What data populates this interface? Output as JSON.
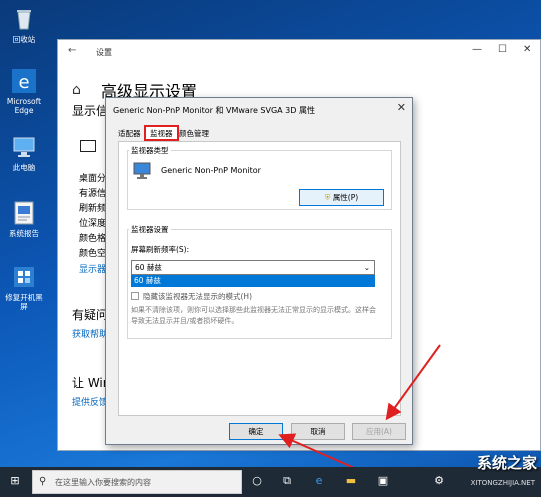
{
  "desktop": {
    "icons": [
      {
        "label": "回收站",
        "icon": "recycle-bin-icon"
      },
      {
        "label": "Microsoft Edge",
        "icon": "edge-icon"
      },
      {
        "label": "此电脑",
        "icon": "computer-icon"
      },
      {
        "label": "系统报告",
        "icon": "report-icon"
      },
      {
        "label": "修复开机黑屏",
        "icon": "tool-icon"
      }
    ]
  },
  "settings": {
    "window_title": "设置",
    "back": "←",
    "controls": {
      "minimize": "—",
      "maximize": "☐",
      "close": "✕"
    },
    "heading": "高级显示设置",
    "subheading": "显示信",
    "items": [
      "桌面分",
      "有源信",
      "刷新频",
      "位深度",
      "颜色格",
      "颜色空"
    ],
    "link": "显示器",
    "help_heading": "有疑问",
    "help_link": "获取帮助",
    "improve_heading": "让 Win",
    "feedback_link": "提供反馈"
  },
  "dialog": {
    "title": "Generic Non-PnP Monitor 和 VMware SVGA 3D 属性",
    "close": "✕",
    "tabs": [
      "适配器",
      "监视器",
      "颜色管理"
    ],
    "active_tab": 1,
    "monitor_type": {
      "group_label": "监视器类型",
      "name": "Generic Non-PnP Monitor",
      "properties_button": "属性(P)"
    },
    "monitor_settings": {
      "group_label": "监视器设置",
      "refresh_label": "屏幕刷新频率(S):",
      "refresh_value": "60 赫兹",
      "dropdown_options": [
        "60 赫兹"
      ],
      "hide_modes_label": "隐藏该监视器无法显示的模式(H)",
      "note": "如果不清除该项，则你可以选择那些此监视器无法正常显示的显示模式。这样会导致无法显示并且/或者损坏硬件。"
    },
    "buttons": {
      "ok": "确定",
      "cancel": "取消",
      "apply": "应用(A)"
    }
  },
  "taskbar": {
    "search_placeholder": "在这里输入你要搜索的内容",
    "time": ""
  },
  "watermark": {
    "text": "系统之家",
    "sub": "XITONGZHIJIA.NET"
  },
  "colors": {
    "accent": "#0078d7",
    "annotation": "#e02020",
    "taskbar": "#1e2a36"
  }
}
